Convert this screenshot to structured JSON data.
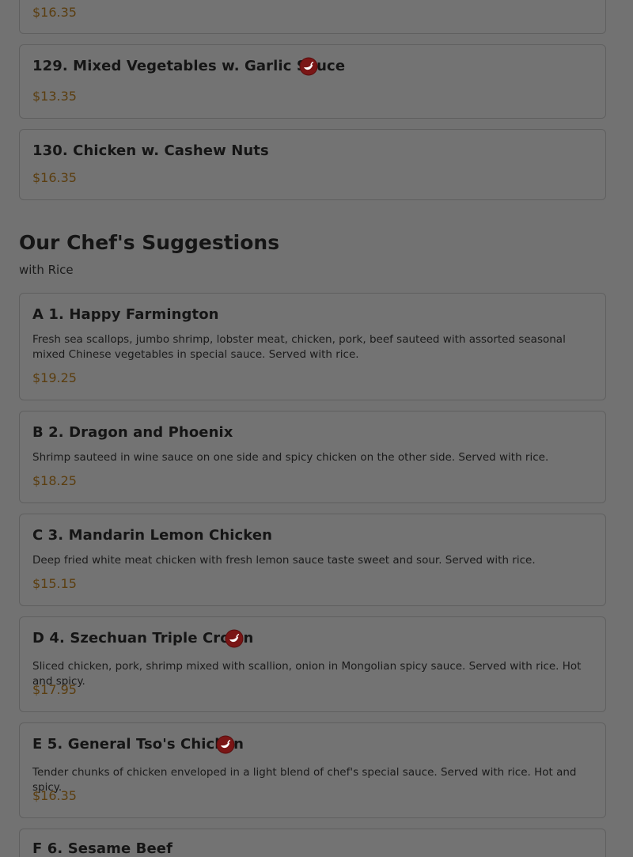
{
  "top_item": {
    "price": "$16.35"
  },
  "items_top": [
    {
      "name": "129. Mixed Vegetables w. Garlic Sauce",
      "price": "$13.35",
      "spicy": true
    },
    {
      "name": "130. Chicken w. Cashew Nuts",
      "price": "$16.35",
      "spicy": false
    }
  ],
  "section": {
    "title": "Our Chef's Suggestions",
    "subtitle": "with Rice"
  },
  "chef_items": [
    {
      "name": "A 1. Happy Farmington",
      "desc": "Fresh sea scallops, jumbo shrimp, lobster meat, chicken, pork, beef sauteed with assorted seasonal mixed Chinese vegetables in special sauce. Served with rice.",
      "price": "$19.25",
      "spicy": false
    },
    {
      "name": "B 2. Dragon and Phoenix",
      "desc": "Shrimp sauteed in wine sauce on one side and spicy chicken on the other side. Served with rice.",
      "price": "$18.25",
      "spicy": false
    },
    {
      "name": "C 3. Mandarin Lemon Chicken",
      "desc": "Deep fried white meat chicken with fresh lemon sauce taste sweet and sour. Served with rice.",
      "price": "$15.15",
      "spicy": false
    },
    {
      "name": "D 4. Szechuan Triple Crown",
      "desc": "Sliced chicken, pork, shrimp mixed with scallion, onion in Mongolian spicy sauce. Served with rice. Hot and spicy.",
      "price": "$17.95",
      "spicy": true
    },
    {
      "name": "E 5. General Tso's Chicken",
      "desc": "Tender chunks of chicken enveloped in a light blend of chef's special sauce. Served with rice. Hot and spicy.",
      "price": "$16.35",
      "spicy": true
    },
    {
      "name": "F 6. Sesame Beef"
    }
  ],
  "colors": {
    "overlay_background": "#727272",
    "price": "#5b3e10",
    "spicy_icon": "#7a1616"
  },
  "icons": {
    "spicy": "chili-pepper-icon"
  }
}
